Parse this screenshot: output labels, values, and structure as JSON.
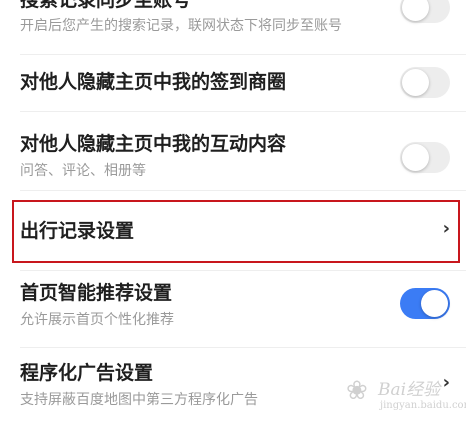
{
  "settings": {
    "sync_search": {
      "title": "搜索记录同步至账号",
      "subtitle": "开启后您产生的搜索记录，联网状态下将同步至账号",
      "enabled": false
    },
    "hide_checkin": {
      "title": "对他人隐藏主页中我的签到商圈",
      "enabled": false
    },
    "hide_interaction": {
      "title": "对他人隐藏主页中我的互动内容",
      "subtitle": "问答、评论、相册等",
      "enabled": false
    },
    "travel_record": {
      "title": "出行记录设置",
      "chevron": "›"
    },
    "homepage_recommend": {
      "title": "首页智能推荐设置",
      "subtitle": "允许展示首页个性化推荐",
      "enabled": true
    },
    "programmatic_ads": {
      "title": "程序化广告设置",
      "subtitle": "支持屏蔽百度地图中第三方程序化广告",
      "chevron": "›"
    }
  },
  "colors": {
    "accent": "#3b7cf5",
    "highlight_border": "#c8171d",
    "toggle_off": "#ededed",
    "title_text": "#1f1f1f",
    "subtitle_text": "#9a9a9a"
  },
  "watermark": {
    "icon": "paw-icon",
    "text": "Bai经验",
    "sub": "jingyan.baidu.com"
  }
}
